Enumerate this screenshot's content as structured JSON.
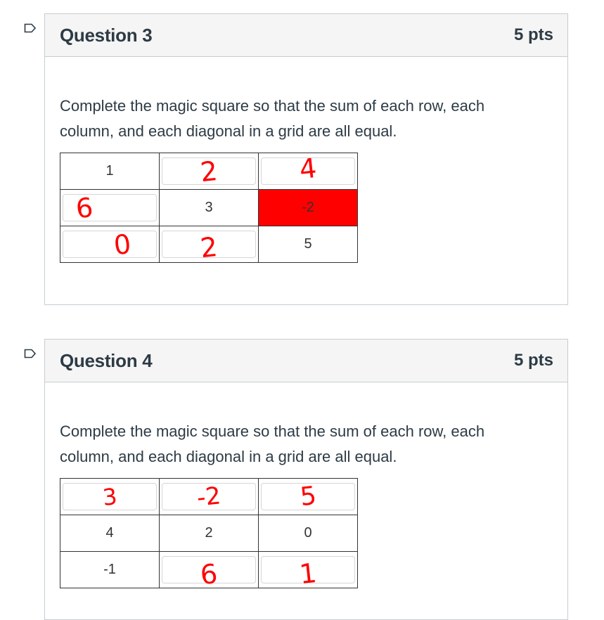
{
  "questions": [
    {
      "title": "Question 3",
      "points": "5 pts",
      "text": "Complete the magic square so that the sum of each row, each column, and each diagonal in a grid are all equal.",
      "grid": [
        [
          {
            "value": "1"
          },
          {
            "answer": "2"
          },
          {
            "answer": "4"
          }
        ],
        [
          {
            "answer": "6"
          },
          {
            "value": "3"
          },
          {
            "value": "-2",
            "highlight": "#ff0000"
          }
        ],
        [
          {
            "answer": "0"
          },
          {
            "answer": "2"
          },
          {
            "value": "5"
          }
        ]
      ]
    },
    {
      "title": "Question 4",
      "points": "5 pts",
      "text": "Complete the magic square so that the sum of each row, each column, and each diagonal in a grid are all equal.",
      "grid": [
        [
          {
            "answer": "3"
          },
          {
            "answer": "-2"
          },
          {
            "answer": "5"
          }
        ],
        [
          {
            "value": "4"
          },
          {
            "value": "2"
          },
          {
            "value": "0"
          }
        ],
        [
          {
            "value": "-1"
          },
          {
            "answer": "6"
          },
          {
            "answer": "1"
          }
        ]
      ]
    }
  ],
  "colors": {
    "handwriting": "#ff0000",
    "highlight": "#ff0000",
    "header_bg": "#f5f5f5",
    "border": "#c7cdd1",
    "text": "#2d3b45"
  },
  "icons": {
    "flag": "flag-icon"
  }
}
